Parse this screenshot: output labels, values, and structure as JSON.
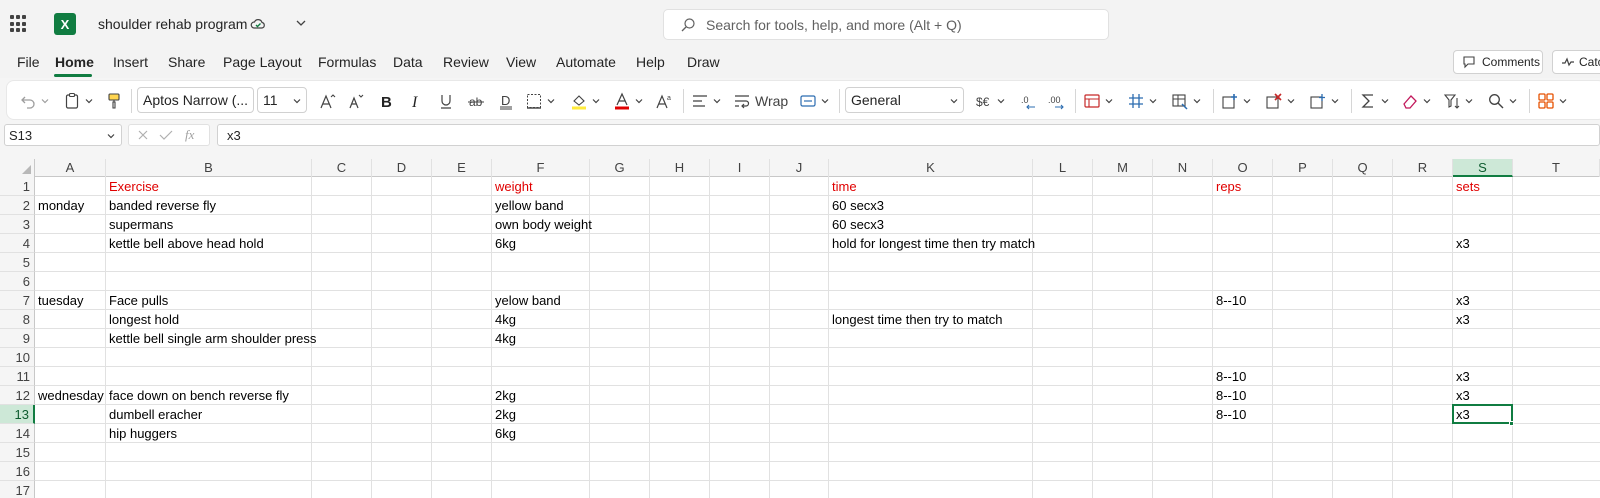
{
  "app": {
    "doc_title": "shoulder rehab program",
    "logo_letter": "X",
    "search_placeholder": "Search for tools, help, and more (Alt + Q)"
  },
  "menu": {
    "tabs": [
      "File",
      "Home",
      "Insert",
      "Share",
      "Page Layout",
      "Formulas",
      "Data",
      "Review",
      "View",
      "Automate",
      "Help",
      "Draw"
    ],
    "active": "Home",
    "comments_label": "Comments",
    "catchup_label": "Catc"
  },
  "ribbon": {
    "font_name": "Aptos Narrow (...",
    "font_size": "11",
    "wrap_label": "Wrap",
    "number_format": "General",
    "fill_color": "#ffeb3b",
    "font_color": "#e00000"
  },
  "formula_bar": {
    "name_box": "S13",
    "fx_label": "fx",
    "formula": "x3"
  },
  "grid": {
    "columns": [
      "A",
      "B",
      "C",
      "D",
      "E",
      "F",
      "G",
      "H",
      "I",
      "J",
      "K",
      "L",
      "M",
      "N",
      "O",
      "P",
      "Q",
      "R",
      "S",
      "T"
    ],
    "rows": [
      "1",
      "2",
      "3",
      "4",
      "5",
      "6",
      "7",
      "8",
      "9",
      "10",
      "11",
      "12",
      "13",
      "14",
      "15",
      "16",
      "17"
    ],
    "selected_col": "S",
    "selected_row": "13",
    "header_color": "#e00000",
    "headers": {
      "B1": "Exercise",
      "F1": "weight",
      "K1": "time",
      "O1": "reps",
      "S1": "sets"
    },
    "cells": {
      "A2": "monday",
      "B2": "banded reverse fly",
      "F2": "yellow band",
      "K2": "60 secx3",
      "B3": "supermans",
      "F3": "own body weight",
      "K3": "60 secx3",
      "B4": "kettle bell above head hold",
      "F4": "6kg",
      "K4": "hold  for longest time then try match",
      "S4": "x3",
      "A7": "tuesday",
      "B7": "Face pulls",
      "F7": "yelow band",
      "O7": "8--10",
      "S7": "x3",
      "B8": "longest hold",
      "F8": "4kg",
      "K8": "longest time then try to match",
      "S8": "x3",
      "B9": "kettle bell single arm shoulder press",
      "F9": "4kg",
      "O11": "8--10",
      "S11": "x3",
      "A12": "wednesday",
      "B12": "face down on bench reverse fly",
      "F12": "2kg",
      "O12": "8--10",
      "S12": "x3",
      "B13": "dumbell eracher",
      "F13": "2kg",
      "O13": "8--10",
      "S13": "x3",
      "B14": "hip huggers",
      "F14": "6kg"
    }
  }
}
